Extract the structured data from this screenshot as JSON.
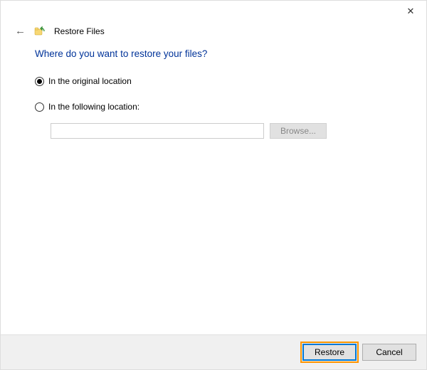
{
  "window": {
    "title": "Restore Files"
  },
  "heading": "Where do you want to restore your files?",
  "options": {
    "original": {
      "label": "In the original location",
      "selected": true
    },
    "following": {
      "label": "In the following location:",
      "selected": false,
      "path_value": "",
      "browse_label": "Browse..."
    }
  },
  "footer": {
    "restore_label": "Restore",
    "cancel_label": "Cancel"
  }
}
